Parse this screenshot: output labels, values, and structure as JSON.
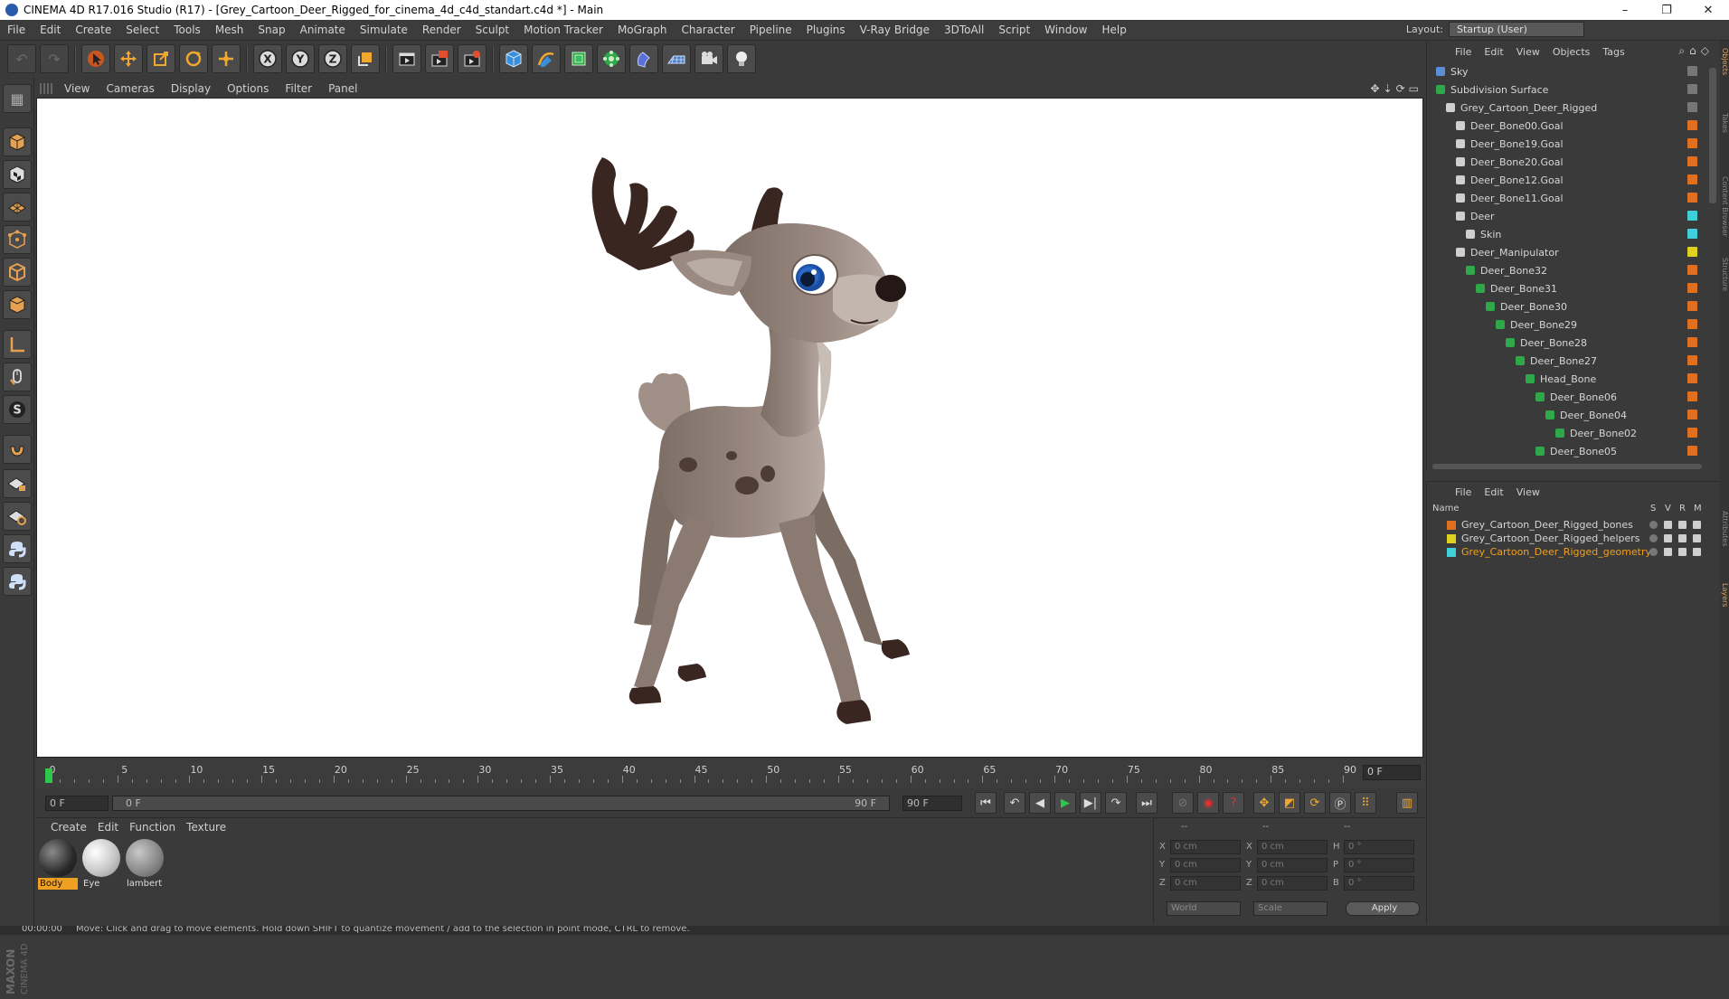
{
  "window": {
    "title": "CINEMA 4D R17.016 Studio (R17) - [Grey_Cartoon_Deer_Rigged_for_cinema_4d_c4d_standart.c4d *] - Main",
    "controls": [
      "–",
      "❐",
      "✕"
    ]
  },
  "menubar": {
    "items": [
      "File",
      "Edit",
      "Create",
      "Select",
      "Tools",
      "Mesh",
      "Snap",
      "Animate",
      "Simulate",
      "Render",
      "Sculpt",
      "Motion Tracker",
      "MoGraph",
      "Character",
      "Pipeline",
      "Plugins",
      "V-Ray Bridge",
      "3DToAll",
      "Script",
      "Window",
      "Help"
    ],
    "layout_label": "Layout:",
    "layout_value": "Startup (User)"
  },
  "viewport": {
    "menu": [
      "View",
      "Cameras",
      "Display",
      "Options",
      "Filter",
      "Panel"
    ]
  },
  "timeline": {
    "ticks": [
      "0",
      "5",
      "10",
      "15",
      "20",
      "25",
      "30",
      "35",
      "40",
      "45",
      "50",
      "55",
      "60",
      "65",
      "70",
      "75",
      "80",
      "85",
      "90"
    ],
    "current_frame": "0 F",
    "start_field": "0 F",
    "range_start": "0 F",
    "range_end": "90 F",
    "end_field": "90 F"
  },
  "materials": {
    "menu": [
      "Create",
      "Edit",
      "Function",
      "Texture"
    ],
    "items": [
      {
        "label": "Body",
        "color": "#444444"
      },
      {
        "label": "Eye",
        "color": "#cccccc"
      },
      {
        "label": "lambert",
        "color": "#9a9a9a"
      }
    ]
  },
  "coordinates": {
    "headers": [
      "--",
      "--",
      "--"
    ],
    "rows": [
      {
        "a": "X",
        "av": "0 cm",
        "b": "X",
        "bv": "0 cm",
        "c": "H",
        "cv": "0 °"
      },
      {
        "a": "Y",
        "av": "0 cm",
        "b": "Y",
        "bv": "0 cm",
        "c": "P",
        "cv": "0 °"
      },
      {
        "a": "Z",
        "av": "0 cm",
        "b": "Z",
        "bv": "0 cm",
        "c": "B",
        "cv": "0 °"
      }
    ],
    "mode": "World",
    "scale": "Scale",
    "apply": "Apply"
  },
  "objects": {
    "menu": [
      "File",
      "Edit",
      "View",
      "Objects",
      "Tags"
    ],
    "rows": [
      {
        "name": "Sky",
        "indent": 0,
        "tag": "#777777"
      },
      {
        "name": "Subdivision Surface",
        "indent": 0,
        "tag": "#777777"
      },
      {
        "name": "Grey_Cartoon_Deer_Rigged",
        "indent": 1,
        "tag": "#777777"
      },
      {
        "name": "Deer_Bone00.Goal",
        "indent": 2,
        "tag": "#e07020"
      },
      {
        "name": "Deer_Bone19.Goal",
        "indent": 2,
        "tag": "#e07020"
      },
      {
        "name": "Deer_Bone20.Goal",
        "indent": 2,
        "tag": "#e07020"
      },
      {
        "name": "Deer_Bone12.Goal",
        "indent": 2,
        "tag": "#e07020"
      },
      {
        "name": "Deer_Bone11.Goal",
        "indent": 2,
        "tag": "#e07020"
      },
      {
        "name": "Deer",
        "indent": 2,
        "tag": "#3fcfd8"
      },
      {
        "name": "Skin",
        "indent": 3,
        "tag": "#3fcfd8"
      },
      {
        "name": "Deer_Manipulator",
        "indent": 2,
        "tag": "#e0d020"
      },
      {
        "name": "Deer_Bone32",
        "indent": 3,
        "tag": "#e07020"
      },
      {
        "name": "Deer_Bone31",
        "indent": 4,
        "tag": "#e07020"
      },
      {
        "name": "Deer_Bone30",
        "indent": 5,
        "tag": "#e07020"
      },
      {
        "name": "Deer_Bone29",
        "indent": 6,
        "tag": "#e07020"
      },
      {
        "name": "Deer_Bone28",
        "indent": 7,
        "tag": "#e07020"
      },
      {
        "name": "Deer_Bone27",
        "indent": 8,
        "tag": "#e07020"
      },
      {
        "name": "Head_Bone",
        "indent": 9,
        "tag": "#e07020"
      },
      {
        "name": "Deer_Bone06",
        "indent": 10,
        "tag": "#e07020"
      },
      {
        "name": "Deer_Bone04",
        "indent": 11,
        "tag": "#e07020"
      },
      {
        "name": "Deer_Bone02",
        "indent": 12,
        "tag": "#e07020"
      },
      {
        "name": "Deer_Bone05",
        "indent": 10,
        "tag": "#e07020"
      }
    ]
  },
  "layers": {
    "menu": [
      "File",
      "Edit",
      "View"
    ],
    "headers": [
      "Name",
      "S",
      "V",
      "R",
      "M"
    ],
    "rows": [
      {
        "name": "Grey_Cartoon_Deer_Rigged_bones",
        "color": "#e07020",
        "text": "#d6d6d6"
      },
      {
        "name": "Grey_Cartoon_Deer_Rigged_helpers",
        "color": "#e0d020",
        "text": "#d6d6d6"
      },
      {
        "name": "Grey_Cartoon_Deer_Rigged_geometry",
        "color": "#3fcfd8",
        "text": "#f0a020"
      }
    ]
  },
  "right_tabs": [
    "Objects",
    "Takes",
    "Content Browser",
    "Structure",
    "Attributes",
    "Layers"
  ],
  "status": {
    "time": "00:00:00",
    "message": "Move: Click and drag to move elements. Hold down SHIFT to quantize movement / add to the selection in point mode, CTRL to remove."
  }
}
